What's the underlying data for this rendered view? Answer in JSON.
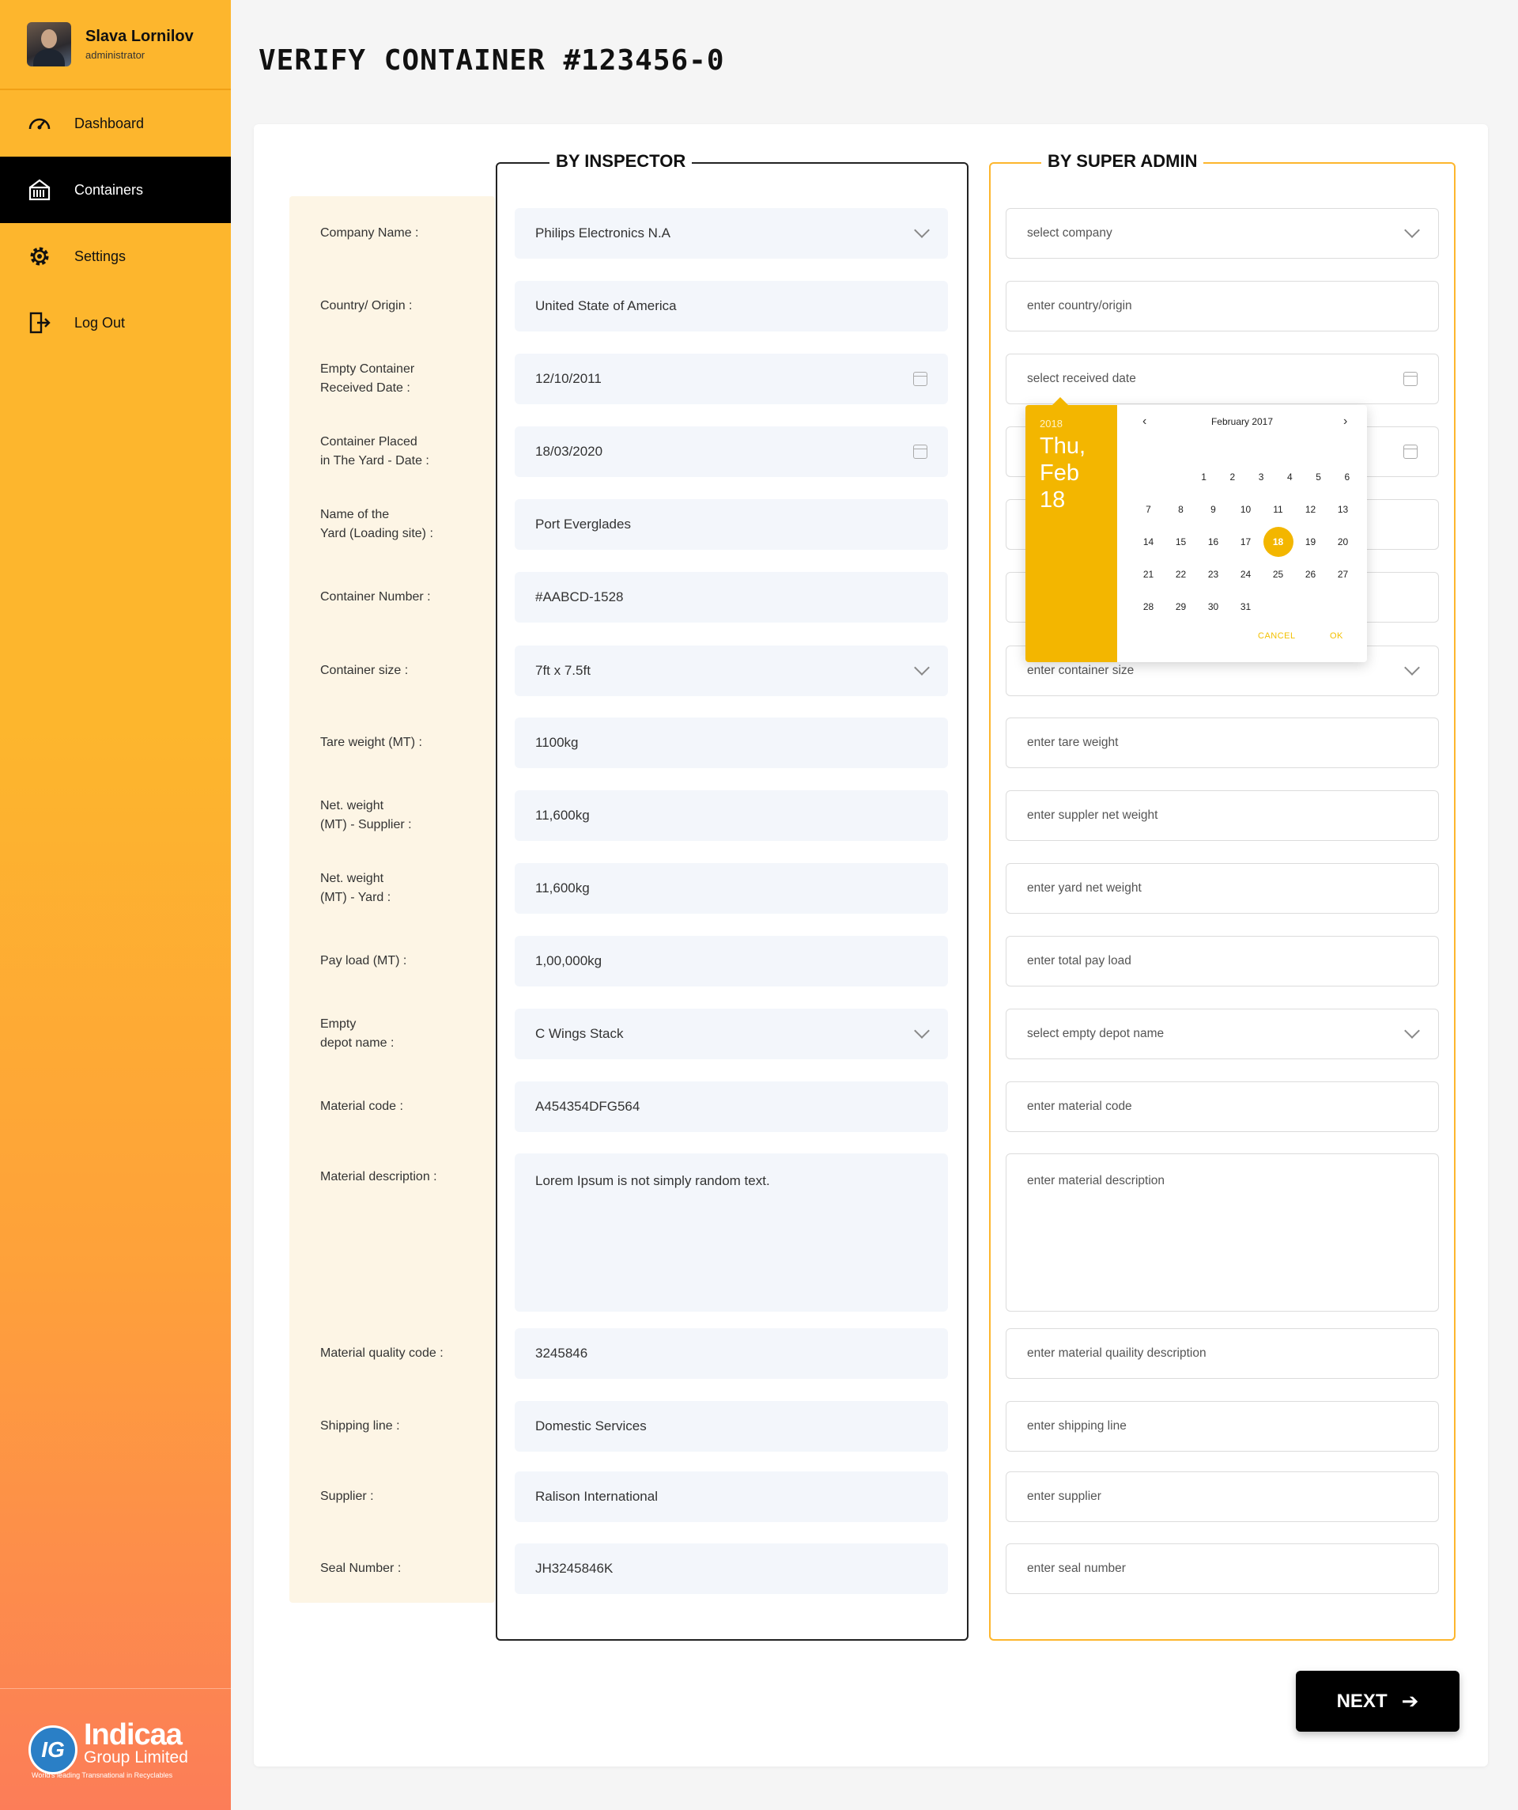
{
  "user": {
    "name": "Slava Lornilov",
    "role": "administrator"
  },
  "nav": [
    {
      "label": "Dashboard",
      "icon": "speedometer-icon"
    },
    {
      "label": "Containers",
      "icon": "container-icon"
    },
    {
      "label": "Settings",
      "icon": "gear-icon"
    },
    {
      "label": "Log Out",
      "icon": "logout-icon"
    }
  ],
  "brand": {
    "name": "Indicaa",
    "sub": "Group Limited",
    "tagline": "World's leading Transnational in Recyclables",
    "mark": "IG"
  },
  "page_title": "VERIFY CONTAINER #123456-0",
  "sections": {
    "inspector": "BY INSPECTOR",
    "admin": "BY SUPER ADMIN"
  },
  "labels": [
    "Company Name :",
    "Country/ Origin :",
    "Empty Container\nReceived Date :",
    "Container Placed\nin The Yard - Date :",
    "Name of the\nYard (Loading site) :",
    "Container Number :",
    "Container size :",
    "Tare weight (MT) :",
    "Net. weight\n(MT) - Supplier :",
    "Net. weight\n(MT) - Yard :",
    "Pay load  (MT) :",
    "Empty\ndepot name  :",
    "Material code :",
    "Material description :",
    "Material quality code :",
    "Shipping line :",
    "Supplier :",
    "Seal Number :"
  ],
  "inspector_values": [
    "Philips Electronics N.A",
    "United State of America",
    "12/10/2011",
    "18/03/2020",
    "Port Everglades",
    "#AABCD-1528",
    "7ft x 7.5ft",
    "1100kg",
    "11,600kg",
    "11,600kg",
    "1,00,000kg",
    "C Wings Stack",
    "A454354DFG564",
    "Lorem Ipsum is not simply random text.",
    "3245846",
    "Domestic Services",
    "Ralison International",
    "JH3245846K"
  ],
  "admin_placeholders": [
    "select company",
    "enter country/origin",
    "select received date",
    "",
    "",
    "",
    "enter container size",
    "enter tare weight",
    "enter suppler net weight",
    "enter yard net weight",
    "enter total pay load",
    "select empty depot name",
    "enter material code",
    "enter material description",
    "enter material quaility description",
    "enter shipping line",
    "enter supplier",
    "enter seal number"
  ],
  "datepicker": {
    "year": "2018",
    "date": "Thu,\nFeb 18",
    "month": "February 2017",
    "prev": "‹",
    "next": "›",
    "selected": 18,
    "cancel": "CANCEL",
    "ok": "OK",
    "weeks": [
      [
        "",
        "",
        "1",
        "2",
        "3",
        "4",
        "5",
        "6"
      ],
      [
        "7",
        "8",
        "9",
        "10",
        "11",
        "12",
        "13"
      ],
      [
        "14",
        "15",
        "16",
        "17",
        "18",
        "19",
        "20"
      ],
      [
        "21",
        "22",
        "23",
        "24",
        "25",
        "26",
        "27"
      ],
      [
        "28",
        "29",
        "30",
        "31",
        "",
        "",
        ""
      ]
    ]
  },
  "next_button": "NEXT",
  "colors": {
    "accent": "#fdb62d",
    "picker": "#f3b600",
    "dark": "#000000",
    "label_bg": "#fdf5e5",
    "field_bg": "#f3f6fb"
  }
}
